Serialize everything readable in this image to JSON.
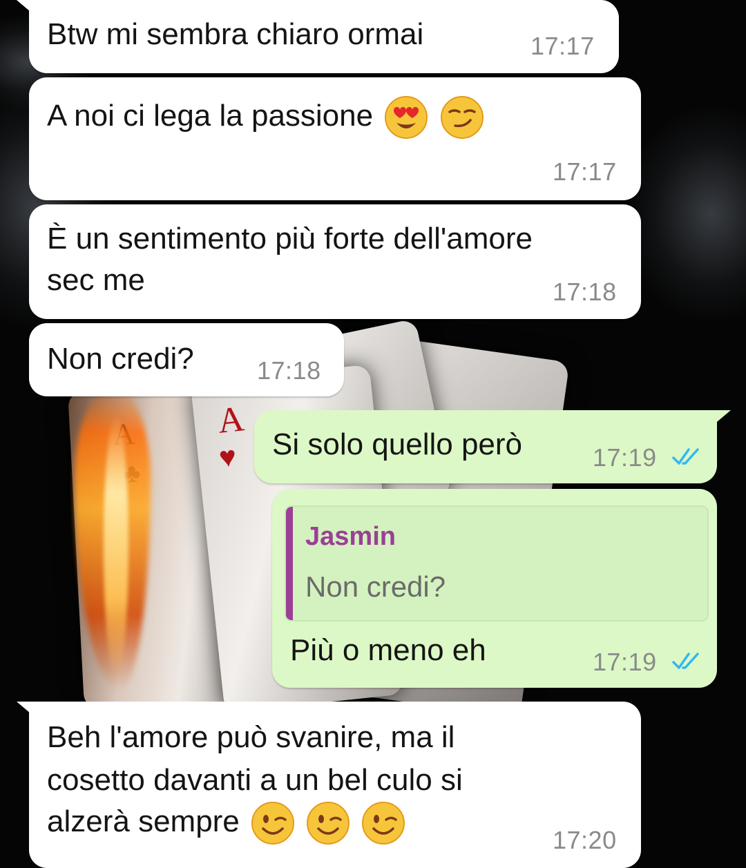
{
  "messages": [
    {
      "id": "m1",
      "direction": "in",
      "lines": [
        "Btw mi sembra chiaro ormai"
      ],
      "time": "17:17"
    },
    {
      "id": "m2",
      "direction": "in",
      "lines": [
        "A noi ci lega la passione"
      ],
      "emojis": [
        "heart-eyes",
        "smirk"
      ],
      "time": "17:17"
    },
    {
      "id": "m3",
      "direction": "in",
      "lines": [
        "È un sentimento più forte dell'amore",
        "sec me"
      ],
      "time": "17:18"
    },
    {
      "id": "m4",
      "direction": "in",
      "lines": [
        "Non credi?"
      ],
      "time": "17:18"
    },
    {
      "id": "m5",
      "direction": "out",
      "lines": [
        "Si solo quello però"
      ],
      "time": "17:19",
      "status": "read"
    },
    {
      "id": "m6",
      "direction": "out",
      "reply": {
        "author": "Jasmin",
        "text": "Non credi?"
      },
      "lines": [
        "Più o meno eh"
      ],
      "time": "17:19",
      "status": "read"
    },
    {
      "id": "m7",
      "direction": "in",
      "lines": [
        "Beh l'amore può svanire, ma il",
        "cosetto davanti a un bel culo si",
        "alzerà sempre"
      ],
      "emojis": [
        "wink",
        "wink",
        "wink"
      ],
      "time": "17:20"
    }
  ],
  "colors": {
    "incoming_bubble": "#ffffff",
    "outgoing_bubble": "#dcf8c6",
    "quote_accent": "#9b3f96",
    "read_ticks": "#34b7f1",
    "timestamp": "#8a8a8a"
  },
  "wallpaper": {
    "icons": [
      "ace-of-clubs-card-icon",
      "ace-of-hearts-card-icon",
      "flame-icon",
      "smoke-icon"
    ]
  }
}
